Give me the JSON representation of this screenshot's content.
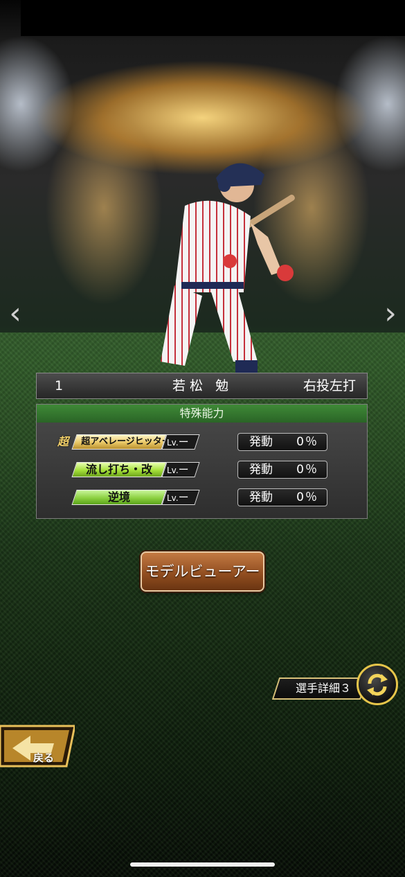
{
  "player": {
    "number": "1",
    "name": "若松 勉",
    "throw_bat": "右投左打"
  },
  "special_abilities": {
    "header": "特殊能力",
    "items": [
      {
        "name": "超アベレージヒッター",
        "prefix": "超",
        "level_label": "Lv.",
        "level": "ー",
        "activation_label": "発動",
        "activation_value": "0％",
        "color": "#e9c765"
      },
      {
        "name": "流し打ち・改",
        "prefix": "",
        "level_label": "Lv.",
        "level": "ー",
        "activation_label": "発動",
        "activation_value": "0％",
        "color": "#a4df3a"
      },
      {
        "name": "逆境",
        "prefix": "",
        "level_label": "Lv.",
        "level": "ー",
        "activation_label": "発動",
        "activation_value": "0％",
        "color": "#8bd040"
      }
    ]
  },
  "buttons": {
    "model_viewer": "モデルビューアー",
    "player_detail": "選手詳細３",
    "back": "戻る"
  },
  "icons": {
    "prev": "chevron-left-icon",
    "next": "chevron-right-icon",
    "cycle": "cycle-arrows-icon",
    "back_arrow": "back-arrow-icon"
  },
  "arrows": {
    "prev_glyph": "‹",
    "next_glyph": "›"
  }
}
